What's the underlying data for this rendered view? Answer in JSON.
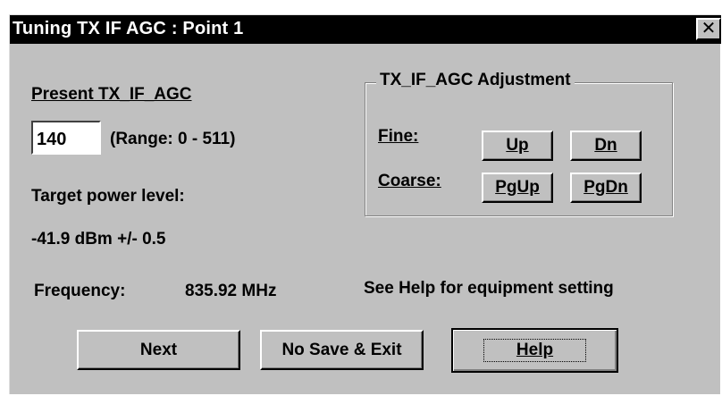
{
  "window": {
    "title": "Tuning TX IF AGC : Point 1",
    "close_glyph": "✕"
  },
  "present": {
    "label": "Present TX_IF_AGC",
    "value": "140",
    "range": "(Range: 0 - 511)"
  },
  "target": {
    "label": "Target power level:",
    "value": "-41.9 dBm +/- 0.5"
  },
  "frequency": {
    "label": "Frequency:",
    "value": "835.92 MHz"
  },
  "help_note": "See Help for equipment setting",
  "adjust": {
    "legend": "TX_IF_AGC Adjustment",
    "fine_label": "Fine:",
    "coarse_label": "Coarse:",
    "up": "Up",
    "dn": "Dn",
    "pgup": "PgUp",
    "pgdn": "PgDn"
  },
  "buttons": {
    "next": "Next",
    "nosave": "No Save & Exit",
    "help": "Help"
  }
}
